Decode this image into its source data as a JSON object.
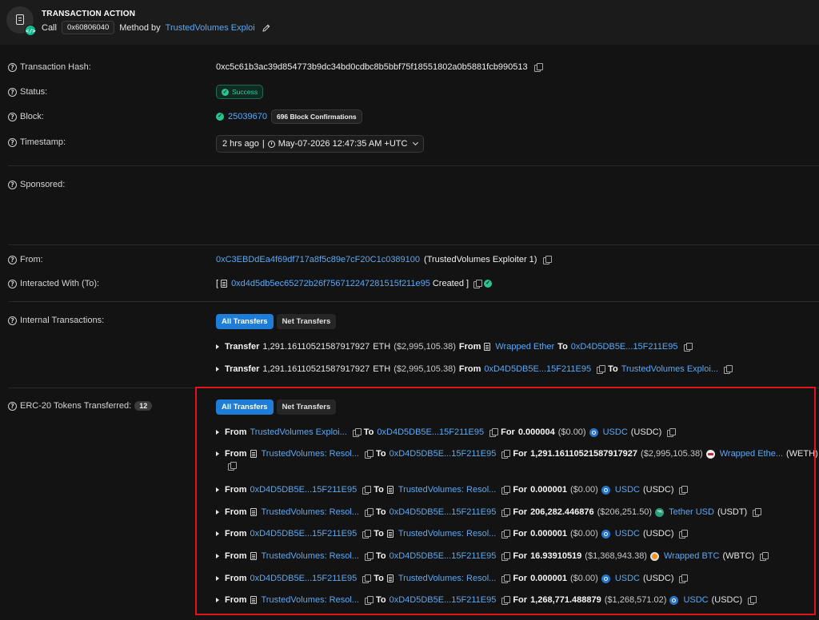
{
  "header": {
    "title": "TRANSACTION ACTION",
    "call": "Call",
    "method_id": "0x60806040",
    "method_by": "Method by",
    "method_target": "TrustedVolumes Exploi"
  },
  "fields": {
    "tx_hash_label": "Transaction Hash:",
    "tx_hash": "0xc5c61b3ac39d854773b9dc34bd0cdbc8b5bbf75f18551802a0b5881fcb990513",
    "status_label": "Status:",
    "status": "Success",
    "block_label": "Block:",
    "block": "25039670",
    "confirmations": "696 Block Confirmations",
    "timestamp_label": "Timestamp:",
    "timestamp_ago": "2 hrs ago",
    "timestamp_sep": "|",
    "timestamp": "May-07-2026 12:47:35 AM +UTC",
    "sponsored_label": "Sponsored:",
    "from_label": "From:",
    "from_address": "0xC3EBDdEa4f69df717a8f5c89e7cF20C1c0389100",
    "from_name": "(TrustedVolumes Exploiter 1)",
    "to_label": "Interacted With (To):",
    "to_open": "[",
    "to_address": "0xd4d5db5ec65272b26f756712247281515f211e95",
    "to_created": "Created ]",
    "internal_label": "Internal Transactions:",
    "erc20_label": "ERC-20 Tokens Transferred:",
    "erc20_count": "12"
  },
  "tabs": {
    "all": "All Transfers",
    "net": "Net Transfers"
  },
  "internal": [
    {
      "prefix": "Transfer",
      "amount": "1,291.16110521587917927",
      "unit": "ETH",
      "usd": "($2,995,105.38)",
      "from_word": "From",
      "from": "Wrapped Ether",
      "to_word": "To",
      "to": "0xD4D5DB5E...15F211E95"
    },
    {
      "prefix": "Transfer",
      "amount": "1,291.16110521587917927",
      "unit": "ETH",
      "usd": "($2,995,105.38)",
      "from_word": "From",
      "from": "0xD4D5DB5E...15F211E95",
      "to_word": "To",
      "to": "TrustedVolumes Exploi..."
    }
  ],
  "erc20": [
    {
      "from": "TrustedVolumes Exploi...",
      "to": "0xD4D5DB5E...15F211E95",
      "amount": "0.000004",
      "usd": "($0.00)",
      "token": "USDC",
      "symbol": "(USDC)",
      "icon": "usdc"
    },
    {
      "from": "TrustedVolumes: Resol...",
      "to": "0xD4D5DB5E...15F211E95",
      "amount": "1,291.16110521587917927",
      "usd": "($2,995,105.38)",
      "token": "Wrapped Ethe...",
      "symbol": "(WETH)",
      "icon": "weth"
    },
    {
      "from": "0xD4D5DB5E...15F211E95",
      "to": "TrustedVolumes: Resol...",
      "amount": "0.000001",
      "usd": "($0.00)",
      "token": "USDC",
      "symbol": "(USDC)",
      "icon": "usdc"
    },
    {
      "from": "TrustedVolumes: Resol...",
      "to": "0xD4D5DB5E...15F211E95",
      "amount": "206,282.446876",
      "usd": "($206,251.50)",
      "token": "Tether USD",
      "symbol": "(USDT)",
      "icon": "usdt"
    },
    {
      "from": "0xD4D5DB5E...15F211E95",
      "to": "TrustedVolumes: Resol...",
      "amount": "0.000001",
      "usd": "($0.00)",
      "token": "USDC",
      "symbol": "(USDC)",
      "icon": "usdc"
    },
    {
      "from": "TrustedVolumes: Resol...",
      "to": "0xD4D5DB5E...15F211E95",
      "amount": "16.93910519",
      "usd": "($1,368,943.38)",
      "token": "Wrapped BTC",
      "symbol": "(WBTC)",
      "icon": "wbtc"
    },
    {
      "from": "0xD4D5DB5E...15F211E95",
      "to": "TrustedVolumes: Resol...",
      "amount": "0.000001",
      "usd": "($0.00)",
      "token": "USDC",
      "symbol": "(USDC)",
      "icon": "usdc"
    },
    {
      "from": "TrustedVolumes: Resol...",
      "to": "0xD4D5DB5E...15F211E95",
      "amount": "1,268,771.488879",
      "usd": "($1,268,571.02)",
      "token": "USDC",
      "symbol": "(USDC)",
      "icon": "usdc"
    }
  ],
  "words": {
    "from": "From",
    "to": "To",
    "for": "For"
  },
  "colors": {
    "link": "#5aa8f3",
    "accent": "#1e7dd6",
    "success": "#2fd3a0",
    "highlight": "#e0141b"
  }
}
